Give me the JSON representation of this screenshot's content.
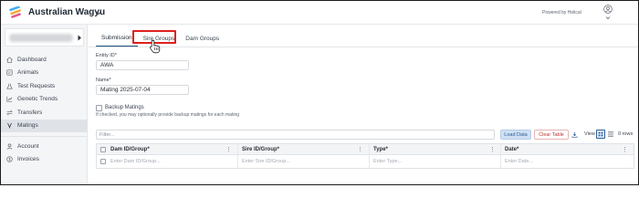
{
  "app": {
    "title": "Australian Wagyu",
    "powered_by": "Powered by Helical"
  },
  "sidebar": {
    "items": [
      {
        "label": "Dashboard",
        "icon": "home-icon"
      },
      {
        "label": "Animals",
        "icon": "animals-icon"
      },
      {
        "label": "Test Requests",
        "icon": "test-requests-icon"
      },
      {
        "label": "Genetic Trends",
        "icon": "chart-icon"
      },
      {
        "label": "Transfers",
        "icon": "transfers-icon"
      },
      {
        "label": "Matings",
        "icon": "matings-icon",
        "active": true
      },
      {
        "label": "Account",
        "icon": "account-icon"
      },
      {
        "label": "Invoices",
        "icon": "invoices-icon"
      }
    ]
  },
  "tabs": [
    {
      "label": "Submission",
      "active": true
    },
    {
      "label": "Sire Groups",
      "highlighted": true
    },
    {
      "label": "Dam Groups"
    }
  ],
  "form": {
    "entity_label": "Entity ID*",
    "entity_value": "AWA",
    "name_label": "Name*",
    "name_value": "Mating 2025-07-04",
    "backup_label": "Backup Matings",
    "backup_hint": "If checked, you may optionally provide backup matings for each mating",
    "backup_checked": false
  },
  "toolbar": {
    "filter_placeholder": "Filter...",
    "load_label": "Load Data",
    "clear_label": "Clear Table",
    "view_label": "View",
    "rows_count": "0 rows"
  },
  "grid": {
    "columns": [
      {
        "header": "Dam ID/Group*",
        "placeholder": "Enter Dam ID/Group..."
      },
      {
        "header": "Sire ID/Group*",
        "placeholder": "Enter Sire ID/Group..."
      },
      {
        "header": "Type*",
        "placeholder": "Enter Type..."
      },
      {
        "header": "Date*",
        "placeholder": "Enter Date..."
      }
    ],
    "menu_glyph": "⋮"
  },
  "colors": {
    "accent": "#2b5f99",
    "highlight_box": "#e02020",
    "danger": "#c03535"
  }
}
